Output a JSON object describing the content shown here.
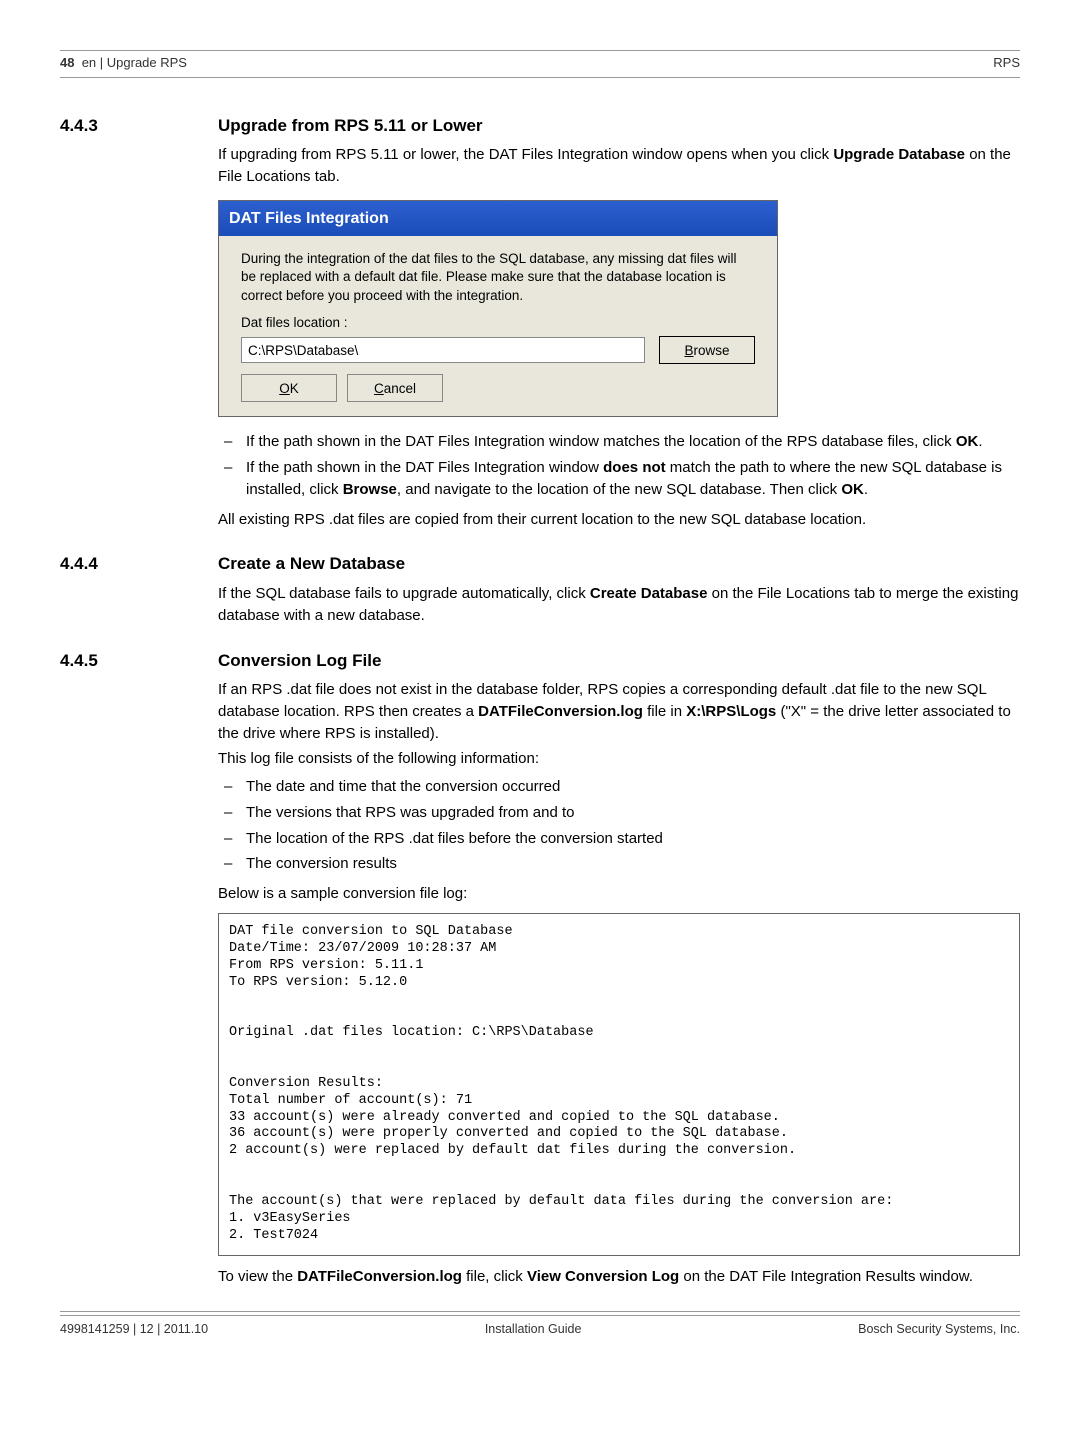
{
  "header": {
    "page_num": "48",
    "breadcrumb": "en | Upgrade RPS",
    "product": "RPS"
  },
  "s443": {
    "num": "4.4.3",
    "title": "Upgrade from RPS 5.11 or Lower",
    "intro_1": "If upgrading from RPS 5.11 or lower, the DAT Files Integration window opens when you click ",
    "intro_bold": "Upgrade Database",
    "intro_2": " on the File Locations tab.",
    "dialog": {
      "title": "DAT Files Integration",
      "body": "During the integration of the dat files to the SQL database, any missing dat files will be replaced with a default dat file. Please make sure that the database location is correct before you proceed with the integration.",
      "label": "Dat files location :",
      "path_value": "C:\\RPS\\Database\\",
      "browse_u": "B",
      "browse_rest": "rowse",
      "ok_u": "O",
      "ok_rest": "K",
      "cancel_pre": "",
      "cancel_u": "C",
      "cancel_rest": "ancel"
    },
    "bullets": {
      "b1_a": "If the path shown in the DAT Files Integration window matches the location of the RPS database files, click ",
      "b1_b": "OK",
      "b1_c": ".",
      "b2_a": "If the path shown in the DAT Files Integration window ",
      "b2_b": "does not",
      "b2_c": " match the path to where the new SQL database is installed, click ",
      "b2_d": "Browse",
      "b2_e": ", and navigate to the location of the new SQL database. Then click ",
      "b2_f": "OK",
      "b2_g": "."
    },
    "after": "All existing RPS .dat files are copied from their current location to the new SQL database location."
  },
  "s444": {
    "num": "4.4.4",
    "title": "Create a New Database",
    "p1_a": "If the SQL database fails to upgrade automatically, click ",
    "p1_b": "Create Database",
    "p1_c": " on the File Locations tab to merge the existing database with a new database."
  },
  "s445": {
    "num": "4.4.5",
    "title": "Conversion Log File",
    "p1_a": "If an RPS .dat file does not exist in the database folder, RPS copies a corresponding default .dat file to the new SQL database location. RPS then creates a ",
    "p1_b": "DATFileConversion.log",
    "p1_c": " file in ",
    "p2_a": "X:\\RPS\\Logs",
    "p2_b": " (\"X\" = the drive letter associated to the drive where RPS is installed).",
    "p3": "This log file consists of the following information:",
    "bullets": {
      "b1": "The date and time that the conversion occurred",
      "b2": "The versions that RPS was upgraded from and to",
      "b3": "The location of the RPS .dat files before the conversion started",
      "b4": "The conversion results"
    },
    "p4": "Below is a sample conversion file log:",
    "log": "DAT file conversion to SQL Database\nDate/Time: 23/07/2009 10:28:37 AM\nFrom RPS version: 5.11.1\nTo RPS version: 5.12.0\n\n\nOriginal .dat files location: C:\\RPS\\Database\n\n\nConversion Results:\nTotal number of account(s): 71\n33 account(s) were already converted and copied to the SQL database.\n36 account(s) were properly converted and copied to the SQL database.\n2 account(s) were replaced by default dat files during the conversion.\n\n\nThe account(s) that were replaced by default data files during the conversion are:\n1. v3EasySeries\n2. Test7024",
    "p5_a": "To view the ",
    "p5_b": "DATFileConversion.log",
    "p5_c": " file, click ",
    "p5_d": "View Conversion Log",
    "p5_e": " on the DAT File Integration Results window."
  },
  "footer": {
    "left": "4998141259 | 12 | 2011.10",
    "center": "Installation Guide",
    "right": "Bosch Security Systems, Inc."
  }
}
